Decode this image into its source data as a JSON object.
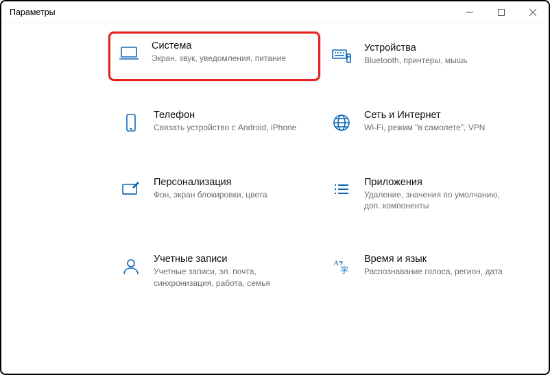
{
  "window": {
    "title": "Параметры"
  },
  "tiles": {
    "system": {
      "title": "Система",
      "desc": "Экран, звук, уведомления, питание"
    },
    "devices": {
      "title": "Устройства",
      "desc": "Bluetooth, принтеры, мышь"
    },
    "phone": {
      "title": "Телефон",
      "desc": "Связать устройство с Android, iPhone"
    },
    "network": {
      "title": "Сеть и Интернет",
      "desc": "Wi-Fi, режим \"в самолете\", VPN"
    },
    "personal": {
      "title": "Персонализация",
      "desc": "Фон, экран блокировки, цвета"
    },
    "apps": {
      "title": "Приложения",
      "desc": "Удаление, значения по умолчанию, доп. компоненты"
    },
    "accounts": {
      "title": "Учетные записи",
      "desc": "Учетные записи, эл. почта, синхронизация, работа, семья"
    },
    "timelang": {
      "title": "Время и язык",
      "desc": "Распознавание голоса, регион, дата"
    }
  }
}
